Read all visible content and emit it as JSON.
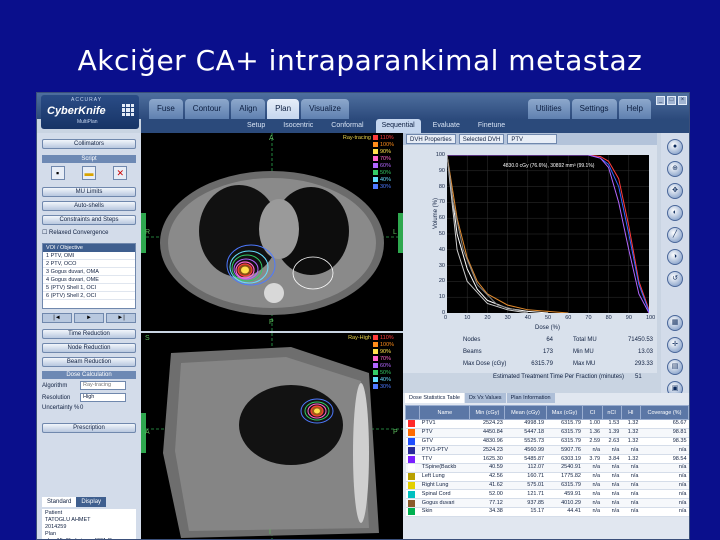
{
  "slide_title": "Akciğer CA+ intraparankimal metastaz",
  "app": {
    "brand": "CyberKnife",
    "brand_sub": "MultiPlan",
    "maker": "ACCURAY"
  },
  "main_tabs": [
    "Fuse",
    "Contour",
    "Align",
    "Plan",
    "Visualize"
  ],
  "active_main_tab": "Plan",
  "right_tabs": [
    "Utilities",
    "Settings",
    "Help"
  ],
  "sub_tabs": [
    "Setup",
    "Isocentric",
    "Conformal",
    "Sequential",
    "Evaluate",
    "Finetune"
  ],
  "active_sub_tab": "Sequential",
  "left_panel": {
    "collimators": "Collimators",
    "script": "Script",
    "mu_limits": "MU Limits",
    "auto_shells": "Auto-shells",
    "constraints": "Constraints and Steps",
    "relaxed": "Relaxed Convergence",
    "voi_header": "VOI / Objective",
    "voi_rows": [
      "1  PTV, OMI",
      "2  PTV, OCO",
      "3  Gogus duvari, OMA",
      "4  Gogus duvari, OME",
      "5  (PTV) Shell 1, OCI",
      "6  (PTV) Shell 2, OCI"
    ],
    "time_reduction": "Time Reduction",
    "node_reduction": "Node Reduction",
    "beam_reduction": "Beam Reduction",
    "dose_calc": "Dose Calculation",
    "algorithm_label": "Algorithm",
    "algorithm_value": "Ray-tracing",
    "resolution_label": "Resolution",
    "resolution_value": "High",
    "uncertainty_label": "Uncertainty %",
    "uncertainty_value": "0",
    "prescription": "Prescription",
    "status_tabs": [
      "Standard",
      "Display"
    ],
    "patient_lines": [
      "Patient",
      "TATOGLU AHMET",
      "2014259",
      "Plan",
      "akc_15_3fraksiyon_4001-Ry",
      "01-JUL-2014, 12:30:00 AM",
      "Rx"
    ]
  },
  "ct": {
    "axial_mode": "Ray-tracing",
    "sag_mode": "Ray-High",
    "isodose_levels": [
      "110%",
      "100%",
      "90%",
      "70%",
      "60%",
      "50%",
      "40%",
      "30%"
    ],
    "isodose_colors": [
      "#ff3b3b",
      "#ff8c1a",
      "#ffe14d",
      "#ff66cc",
      "#b266ff",
      "#33cc66",
      "#66ddff",
      "#4d79ff"
    ],
    "axial_labels": [
      "A",
      "R",
      "L",
      "P"
    ],
    "sag_labels": [
      "S",
      "A",
      "P",
      "I"
    ]
  },
  "dvh": {
    "toolbar": [
      "DVH Properties",
      "Selected DVH",
      "PTV"
    ],
    "ylabel": "Volume (%)",
    "xlabel": "Dose (%)",
    "yticks": [
      "100",
      "90",
      "80",
      "70",
      "60",
      "50",
      "40",
      "30",
      "20",
      "10",
      "0"
    ],
    "xticks": [
      "0",
      "10",
      "20",
      "30",
      "40",
      "50",
      "60",
      "70",
      "80",
      "90",
      "100"
    ],
    "annotation": "4830.0 cGy (76.6%), 30892 mm³ (99.1%)"
  },
  "chart_data": {
    "type": "line",
    "xlabel": "Dose (%)",
    "ylabel": "Volume (%)",
    "xlim": [
      0,
      100
    ],
    "ylim": [
      0,
      100
    ],
    "series": [
      {
        "color": "#ff3b3b",
        "x": [
          0,
          60,
          70,
          76,
          80,
          85,
          90,
          95,
          100
        ],
        "y": [
          100,
          100,
          100,
          99,
          96,
          85,
          55,
          20,
          2
        ]
      },
      {
        "color": "#3366ff",
        "x": [
          0,
          60,
          70,
          76,
          80,
          85,
          90,
          95,
          100
        ],
        "y": [
          100,
          100,
          100,
          98,
          94,
          80,
          50,
          18,
          1
        ]
      },
      {
        "color": "#b266ff",
        "x": [
          0,
          70,
          76,
          80,
          85,
          90,
          95,
          100
        ],
        "y": [
          100,
          100,
          98,
          92,
          70,
          40,
          12,
          0
        ]
      },
      {
        "color": "#e08a2e",
        "x": [
          0,
          5,
          10,
          15,
          20,
          30,
          40,
          50,
          60
        ],
        "y": [
          100,
          60,
          35,
          20,
          12,
          5,
          2,
          1,
          0
        ]
      },
      {
        "color": "#ffffff",
        "x": [
          0,
          5,
          10,
          15,
          20,
          30,
          40,
          50
        ],
        "y": [
          100,
          50,
          28,
          15,
          8,
          3,
          1,
          0
        ]
      },
      {
        "color": "#cccccc",
        "x": [
          0,
          5,
          10,
          20,
          30,
          40
        ],
        "y": [
          100,
          40,
          20,
          6,
          2,
          0
        ]
      },
      {
        "color": "#888888",
        "x": [
          0,
          3,
          8,
          15,
          25,
          40
        ],
        "y": [
          100,
          70,
          40,
          18,
          5,
          0
        ]
      }
    ]
  },
  "summary": {
    "nodes_label": "Nodes",
    "nodes_value": "64",
    "beams_label": "Beams",
    "beams_value": "173",
    "maxdose_label": "Max Dose (cGy)",
    "maxdose_value": "6315.79",
    "totalmu_label": "Total MU",
    "totalmu_value": "71450.53",
    "minmu_label": "Min MU",
    "minmu_value": "13.03",
    "maxmu_label": "Max MU",
    "maxmu_value": "293.33",
    "est_label": "Estimated Treatment Time Per Fraction (minutes)",
    "est_value": "51"
  },
  "stats": {
    "tabs": [
      "Dose Statistics Table",
      "Dx Vx Values",
      "Plan Information"
    ],
    "headers": [
      "",
      "Name",
      "Min (cGy)",
      "Mean (cGy)",
      "Max (cGy)",
      "CI",
      "nCI",
      "HI",
      "Coverage (%)"
    ],
    "rows": [
      {
        "color": "#ff2a2a",
        "name": "PTV1",
        "min": "2524.23",
        "mean": "4998.19",
        "max": "6315.79",
        "ci": "1.00",
        "nci": "1.53",
        "hi": "1.32",
        "cov": "65.67"
      },
      {
        "color": "#ff6a00",
        "name": "PTV",
        "min": "4450.84",
        "mean": "5447.18",
        "max": "6315.79",
        "ci": "1.36",
        "nci": "1.39",
        "hi": "1.32",
        "cov": "98.81"
      },
      {
        "color": "#1f4fff",
        "name": "GTV",
        "min": "4830.96",
        "mean": "5525.73",
        "max": "6315.79",
        "ci": "2.59",
        "nci": "2.63",
        "hi": "1.32",
        "cov": "98.35"
      },
      {
        "color": "#2a2a9a",
        "name": "PTV1-PTV",
        "min": "2524.23",
        "mean": "4560.99",
        "max": "5907.76",
        "ci": "n/a",
        "nci": "n/a",
        "hi": "n/a",
        "cov": "n/a"
      },
      {
        "color": "#7a1fff",
        "name": "TTV",
        "min": "1625.30",
        "mean": "5485.87",
        "max": "6303.19",
        "ci": "3.79",
        "nci": "3.84",
        "hi": "1.32",
        "cov": "98.54"
      },
      {
        "color": "#ffffff",
        "name": "TSpine(Backb",
        "min": "40.59",
        "mean": "112.07",
        "max": "2540.91",
        "ci": "n/a",
        "nci": "n/a",
        "hi": "n/a",
        "cov": "n/a"
      },
      {
        "color": "#b8a000",
        "name": "Left Lung",
        "min": "42.56",
        "mean": "160.71",
        "max": "1775.82",
        "ci": "n/a",
        "nci": "n/a",
        "hi": "n/a",
        "cov": "n/a"
      },
      {
        "color": "#e3d000",
        "name": "Right Lung",
        "min": "41.62",
        "mean": "575.01",
        "max": "6315.79",
        "ci": "n/a",
        "nci": "n/a",
        "hi": "n/a",
        "cov": "n/a"
      },
      {
        "color": "#00c0c0",
        "name": "Spinal Cord",
        "min": "52.00",
        "mean": "121.71",
        "max": "459.91",
        "ci": "n/a",
        "nci": "n/a",
        "hi": "n/a",
        "cov": "n/a"
      },
      {
        "color": "#8a5a2a",
        "name": "Gogus duvari",
        "min": "77.12",
        "mean": "937.85",
        "max": "4010.29",
        "ci": "n/a",
        "nci": "n/a",
        "hi": "n/a",
        "cov": "n/a"
      },
      {
        "color": "#00b050",
        "name": "Skin",
        "min": "34.38",
        "mean": "15.17",
        "max": "44.41",
        "ci": "n/a",
        "nci": "n/a",
        "hi": "n/a",
        "cov": "n/a"
      }
    ]
  }
}
